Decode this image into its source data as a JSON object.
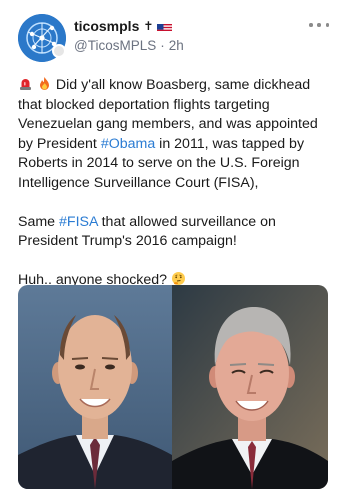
{
  "post": {
    "display_name": "ticosmpls",
    "name_flair": "✝",
    "handle": "@TicosMPLS",
    "separator": "·",
    "timestamp": "2h",
    "paragraph1_part1": "Did y'all know Boasberg, same dickhead that blocked deportation flights targeting Venezuelan gang members, and was appointed by President ",
    "hashtag_obama": "#Obama",
    "paragraph1_part2": " in 2011, was tapped by Roberts in 2014 to serve on the U.S. Foreign Intelligence Surveillance Court (FISA),",
    "paragraph2_part1": "Same ",
    "hashtag_fisa": "#FISA",
    "paragraph2_part2": " that allowed surveillance on President Trump's 2016 campaign!",
    "paragraph3": "Huh.. anyone shocked?",
    "leading_emojis": [
      "siren-icon",
      "fire-icon"
    ],
    "trailing_emoji": "thinking-face-icon",
    "more_icon": "more-horizontal-icon",
    "media": {
      "left_photo": "portrait-bald-man-in-suit",
      "right_photo": "portrait-gray-haired-man-in-robe"
    }
  },
  "colors": {
    "hashtag": "#2b7cd3",
    "handle": "#6b7280",
    "avatar": "#2b78c9"
  }
}
